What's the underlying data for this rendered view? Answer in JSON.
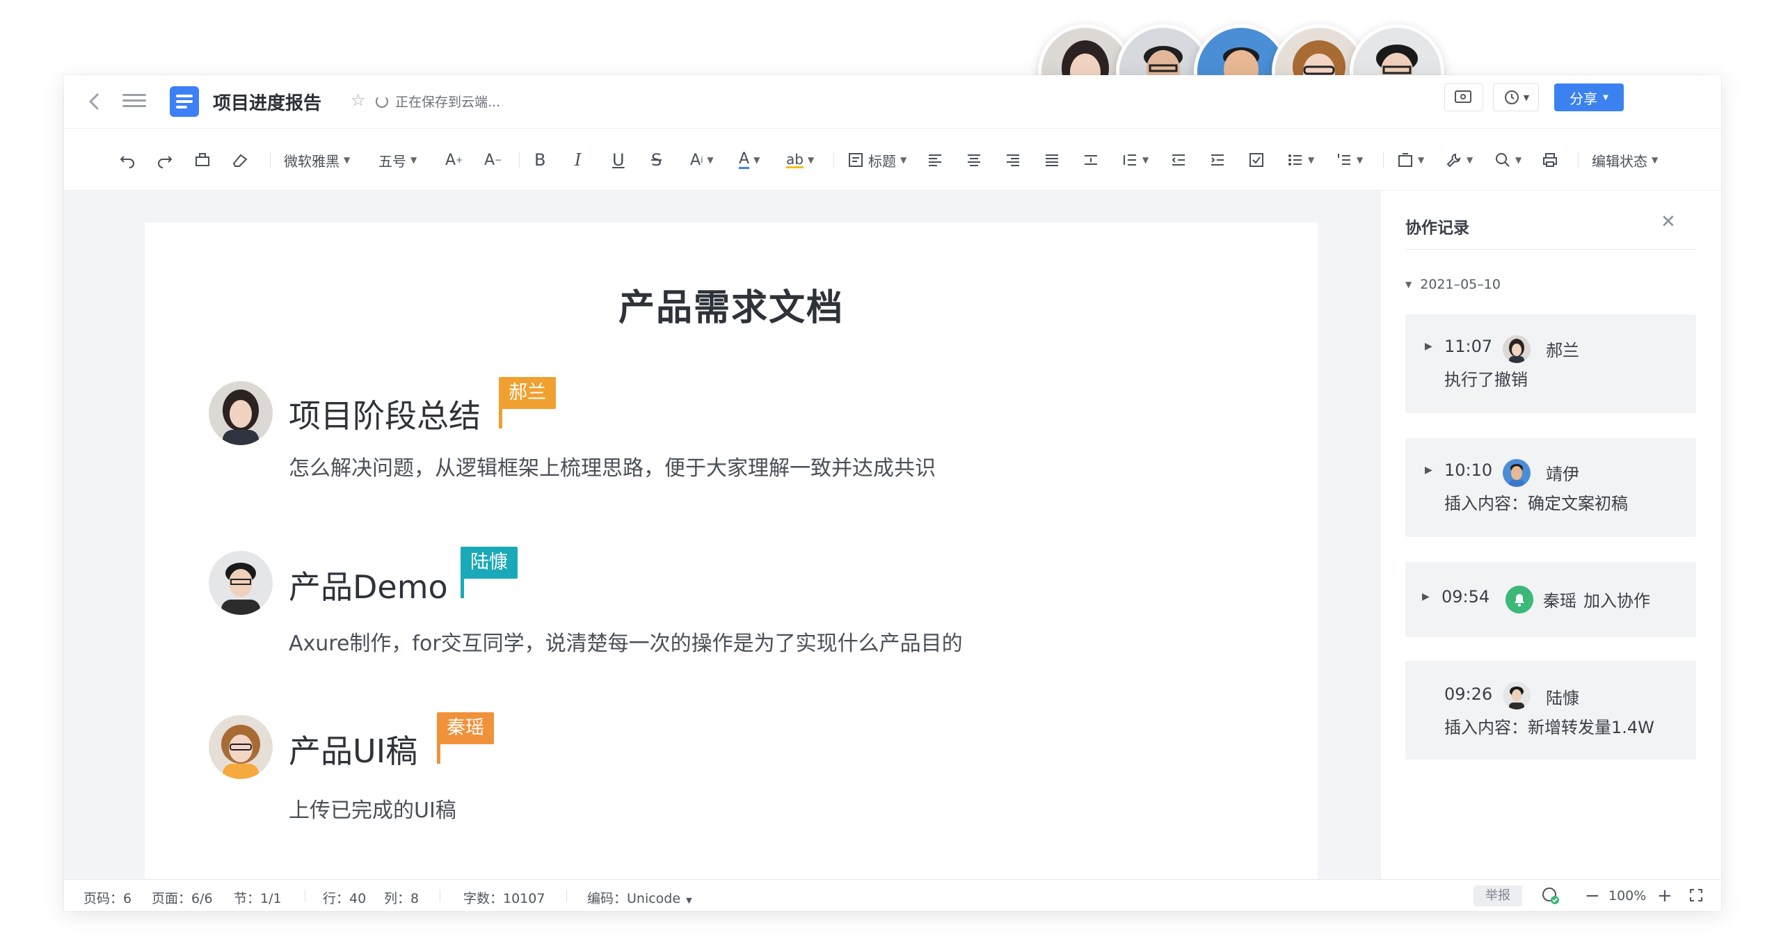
{
  "window": {
    "doc_title": "项目进度报告",
    "saving_status": "正在保存到云端...",
    "share_label": "分享"
  },
  "toolbar": {
    "font_family": "微软雅黑",
    "font_size": "五号",
    "heading_style": "标题",
    "edit_status": "编辑状态"
  },
  "document": {
    "heading": "产品需求文档",
    "sections": [
      {
        "title": "项目阶段总结",
        "text": "怎么解决问题，从逻辑框架上梳理思路，便于大家理解一致并达成共识",
        "editor": "郝兰",
        "flag_color": "#f0a030"
      },
      {
        "title": "产品Demo",
        "text": "Axure制作，for交互同学，说清楚每一次的操作是为了实现什么产品目的",
        "editor": "陆慷",
        "flag_color": "#1aa9b8"
      },
      {
        "title": "产品UI稿",
        "text": "上传已完成的UI稿",
        "editor": "秦瑶",
        "flag_color": "#f0923a"
      }
    ]
  },
  "panel": {
    "title": "协作记录",
    "date": "2021–05–10",
    "records": [
      {
        "time": "11:07",
        "user": "郝兰",
        "action": "执行了撤销"
      },
      {
        "time": "10:10",
        "user": "靖伊",
        "action": "插入内容：确定文案初稿"
      },
      {
        "time": "09:54",
        "user": "秦瑶",
        "action": "加入协作"
      },
      {
        "time": "09:26",
        "user": "陆慷",
        "action": "插入内容：新增转发量1.4W"
      }
    ]
  },
  "statusbar": {
    "page_code": "页码：6",
    "pages": "页面：6/6",
    "section": "节：1/1",
    "line": "行：40",
    "column": "列：8",
    "word_count": "字数：10107",
    "encoding": "编码：Unicode",
    "report": "举报",
    "zoom": "100%"
  }
}
